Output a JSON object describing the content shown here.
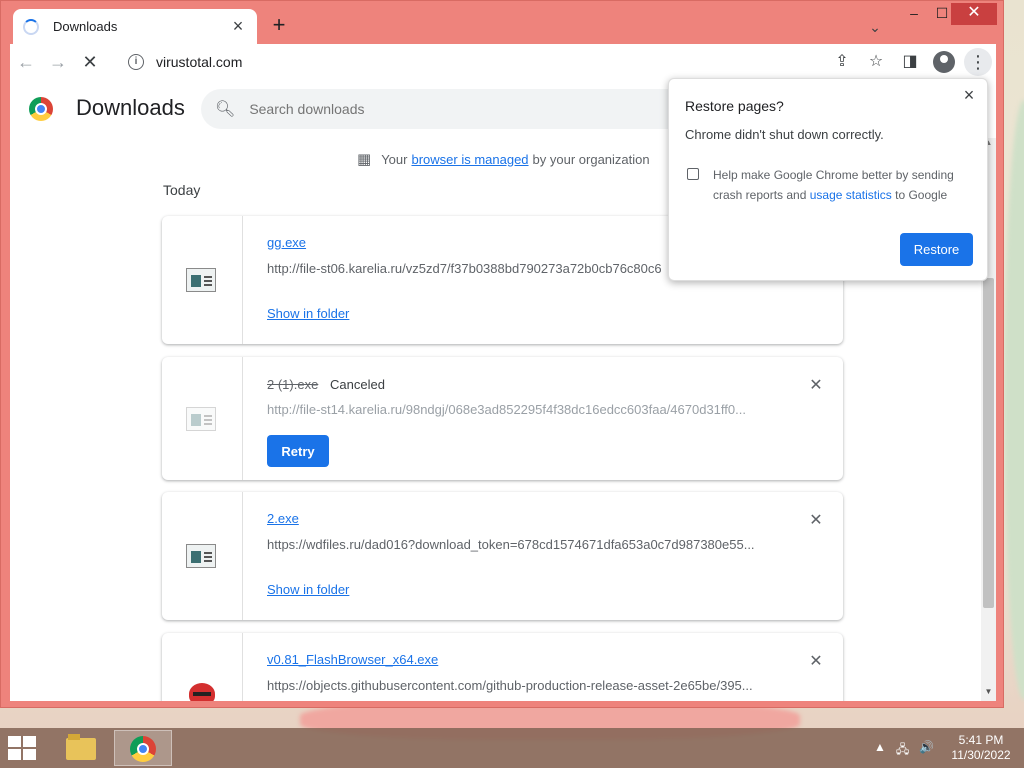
{
  "window": {
    "tab_title": "Downloads",
    "tab_close": "×",
    "new_tab": "+",
    "tab_search": "⌄",
    "minimize": "–",
    "maximize": "☐",
    "close": "✕"
  },
  "toolbar": {
    "back": "←",
    "forward": "→",
    "reload": "✕",
    "site_info": "i",
    "url": "virustotal.com",
    "share": "⇪",
    "bookmark": "☆",
    "sidepanel": "◨",
    "menu": "⋮"
  },
  "page": {
    "title": "Downloads",
    "search_placeholder": "Search downloads",
    "managed_prefix": "Your",
    "managed_link": "browser is managed",
    "managed_suffix": "by your organization",
    "section_label": "Today"
  },
  "downloads": [
    {
      "filename": "gg.exe",
      "url": "http://file-st06.karelia.ru/vz5zd7/f37b0388bd790273a72b0cb76c80c6",
      "action": "Show in folder",
      "remove": "✕"
    },
    {
      "filename": "2 (1).exe",
      "status": "Canceled",
      "url": "http://file-st14.karelia.ru/98ndgj/068e3ad852295f4f38dc16edcc603faa/4670d31ff0...",
      "action": "Retry",
      "remove": "✕"
    },
    {
      "filename": "2.exe",
      "url": "https://wdfiles.ru/dad016?download_token=678cd1574671dfa653a0c7d987380e55...",
      "action": "Show in folder",
      "remove": "✕"
    },
    {
      "filename": "v0.81_FlashBrowser_x64.exe",
      "url": "https://objects.githubusercontent.com/github-production-release-asset-2e65be/395...",
      "remove": "✕"
    }
  ],
  "popup": {
    "title": "Restore pages?",
    "message": "Chrome didn't shut down correctly.",
    "checkbox_text_1": "Help make Google Chrome better by sending crash reports and",
    "checkbox_link": "usage statistics",
    "checkbox_text_2": "to Google",
    "button": "Restore",
    "close": "×"
  },
  "taskbar": {
    "time": "5:41 PM",
    "date": "11/30/2022",
    "tray_up": "▲",
    "tray_network": "🖧",
    "tray_volume": "🔊"
  },
  "colors": {
    "accent": "#1a73e8",
    "frame": "#ee837c"
  }
}
